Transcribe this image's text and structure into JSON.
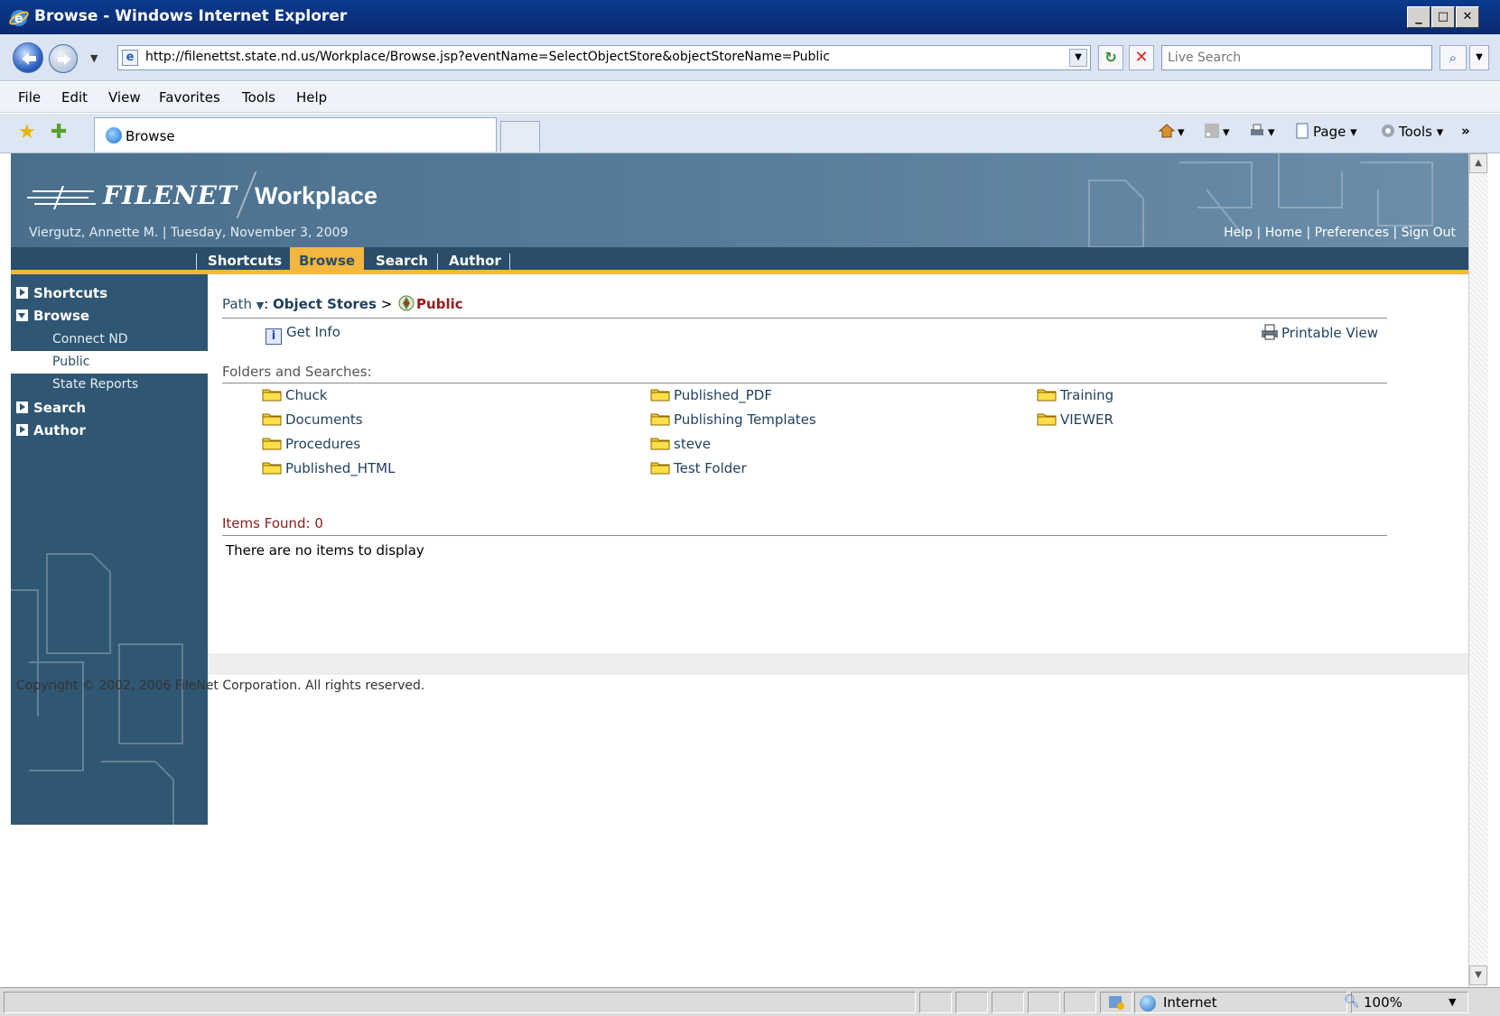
{
  "window": {
    "title": "Browse - Windows Internet Explorer",
    "minimize": "_",
    "maximize": "□",
    "close": "✕"
  },
  "addressbar": {
    "url": "http://filenettst.state.nd.us/Workplace/Browse.jsp?eventName=SelectObjectStore&objectStoreName=Public",
    "search_placeholder": "Live Search"
  },
  "menu": {
    "file": "File",
    "edit": "Edit",
    "view": "View",
    "favorites": "Favorites",
    "tools": "Tools",
    "help": "Help"
  },
  "tabs": {
    "active_tab_label": "Browse"
  },
  "commandbar": {
    "page": "Page",
    "tools": "Tools"
  },
  "header": {
    "brand": "FILENET",
    "app_name": "Workplace",
    "user_info": "Viergutz, Annette M. | Tuesday, November 3, 2009",
    "links": {
      "help": "Help",
      "home": "Home",
      "preferences": "Preferences",
      "sign_out": "Sign Out",
      "sep": "|"
    }
  },
  "main_tabs": {
    "shortcuts": "Shortcuts",
    "browse": "Browse",
    "search": "Search",
    "author": "Author"
  },
  "sidebar": {
    "shortcuts": "Shortcuts",
    "browse": "Browse",
    "items": [
      "Connect ND",
      "Public",
      "State Reports"
    ],
    "search": "Search",
    "author": "Author"
  },
  "content": {
    "path_label": "Path",
    "object_stores": "Object Stores",
    "path_sep": ">",
    "current": "Public",
    "get_info": "Get Info",
    "printable_view": "Printable View",
    "folders_header": "Folders and Searches:",
    "folders": {
      "col1": [
        "Chuck",
        "Documents",
        "Procedures",
        "Published_HTML"
      ],
      "col2": [
        "Published_PDF",
        "Publishing Templates",
        "steve",
        "Test Folder"
      ],
      "col3": [
        "Training",
        "VIEWER"
      ]
    },
    "items_found": "Items Found: 0",
    "no_items": "There are no items to display"
  },
  "footer": {
    "copyright": "Copyright © 2002, 2006 FileNet Corporation. All rights reserved."
  },
  "status": {
    "zone": "Internet",
    "zoom": "100%"
  }
}
